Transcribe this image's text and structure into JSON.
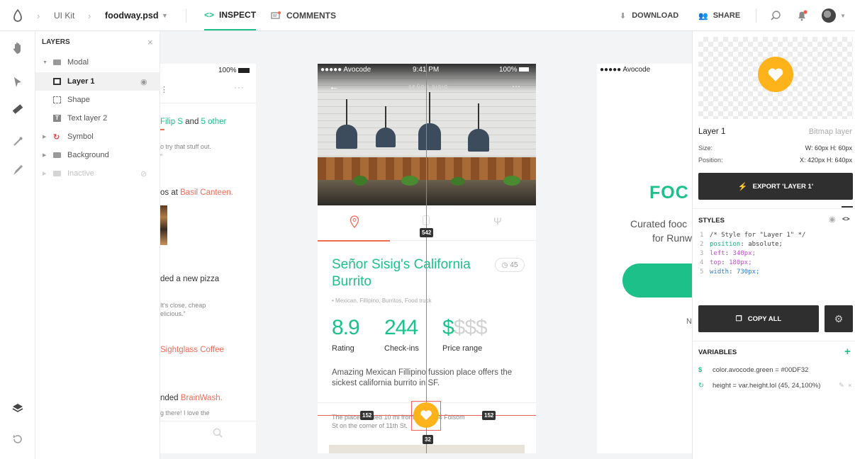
{
  "topbar": {
    "breadcrumb_project": "UI Kit",
    "breadcrumb_file": "foodway.psd",
    "tab_inspect": "INSPECT",
    "tab_comments": "COMMENTS",
    "download": "DOWNLOAD",
    "share": "SHARE"
  },
  "layers_panel": {
    "title": "LAYERS",
    "items": [
      {
        "label": "Modal",
        "icon": "folder-icon"
      },
      {
        "label": "Layer 1",
        "icon": "image-icon"
      },
      {
        "label": "Shape",
        "icon": "shape-icon"
      },
      {
        "label": "Text layer 2",
        "icon": "text-layer-icon"
      },
      {
        "label": "Symbol",
        "icon": "symbol-icon"
      },
      {
        "label": "Background",
        "icon": "folder-icon"
      },
      {
        "label": "Inactive",
        "icon": "folder-icon"
      }
    ]
  },
  "left_art": {
    "battery": "100%",
    "line1a": "Filip S",
    "line1b": " and ",
    "line1c": "5 other",
    "line1d": "",
    "line2": "o try that stuff out.",
    "line3": "”",
    "line4a": "os at ",
    "line4b": "Basil Canteen.",
    "line5": "ded a new pizza",
    "line6a": "It's close, cheap",
    "line6b": "elicious.”",
    "line7": "Sightglass Coffee",
    "line8a": "nded ",
    "line8b": "BrainWash.",
    "line9": "g there! I love the"
  },
  "center_art": {
    "carrier": "●●●●● Avocode",
    "time": "9:41 PM",
    "battery": "100%",
    "header_title": "SEÑOR SISIG",
    "title": "Señor Sisig's California Burrito",
    "badge": "45",
    "tags": "• Mexican, Fillipino, Burritos, Food truck",
    "stats": [
      {
        "value": "8.9",
        "label": "Rating"
      },
      {
        "value": "244",
        "label": "Check-ins"
      },
      {
        "value": "$$$$",
        "label": "Price range"
      }
    ],
    "description": "Amazing Mexican Fillipino fussion place offers the sickest california burrito in SF.",
    "footer_a": "The place located 10 mi from you at 14 Folsom",
    "footer_b": "St on the corner of 11th St.",
    "measure_top": "542",
    "measure_left": "152",
    "measure_right": "152",
    "measure_bottom": "32"
  },
  "right_art": {
    "carrier": "●●●●● Avocode",
    "big_title": "FOC",
    "subtitle_1": "Curated fooc",
    "subtitle_2": "for Runw",
    "n_char": "N"
  },
  "inspector": {
    "layer_name": "Layer 1",
    "layer_type": "Bitmap layer",
    "size_label": "Size:",
    "size_value": "W: 60px  H: 60px",
    "position_label": "Position:",
    "position_value": "X: 420px  H: 640px",
    "export_button": "EXPORT 'LAYER 1'",
    "styles_title": "STYLES",
    "code": [
      {
        "n": "1",
        "text": "/* Style for \"Layer 1\" */"
      },
      {
        "n": "2",
        "prop": "position",
        "val": "absolute;"
      },
      {
        "n": "3",
        "prop": "left",
        "val": "340px;"
      },
      {
        "n": "4",
        "prop": "top",
        "val": "180px;"
      },
      {
        "n": "5",
        "prop": "width",
        "val": "730px;"
      }
    ],
    "copy_all": "COPY ALL",
    "variables_title": "VARIABLES",
    "variables": [
      {
        "text": "color.avocode.green = #00DF32"
      },
      {
        "text": "height = var.height.lol (45, 24,100%)"
      }
    ]
  },
  "colors": {
    "green": "#1ec08a",
    "orange": "#ffb31a",
    "coral": "#ef6a55",
    "dark": "#2f2f2f",
    "measure_red": "#f0605a"
  }
}
